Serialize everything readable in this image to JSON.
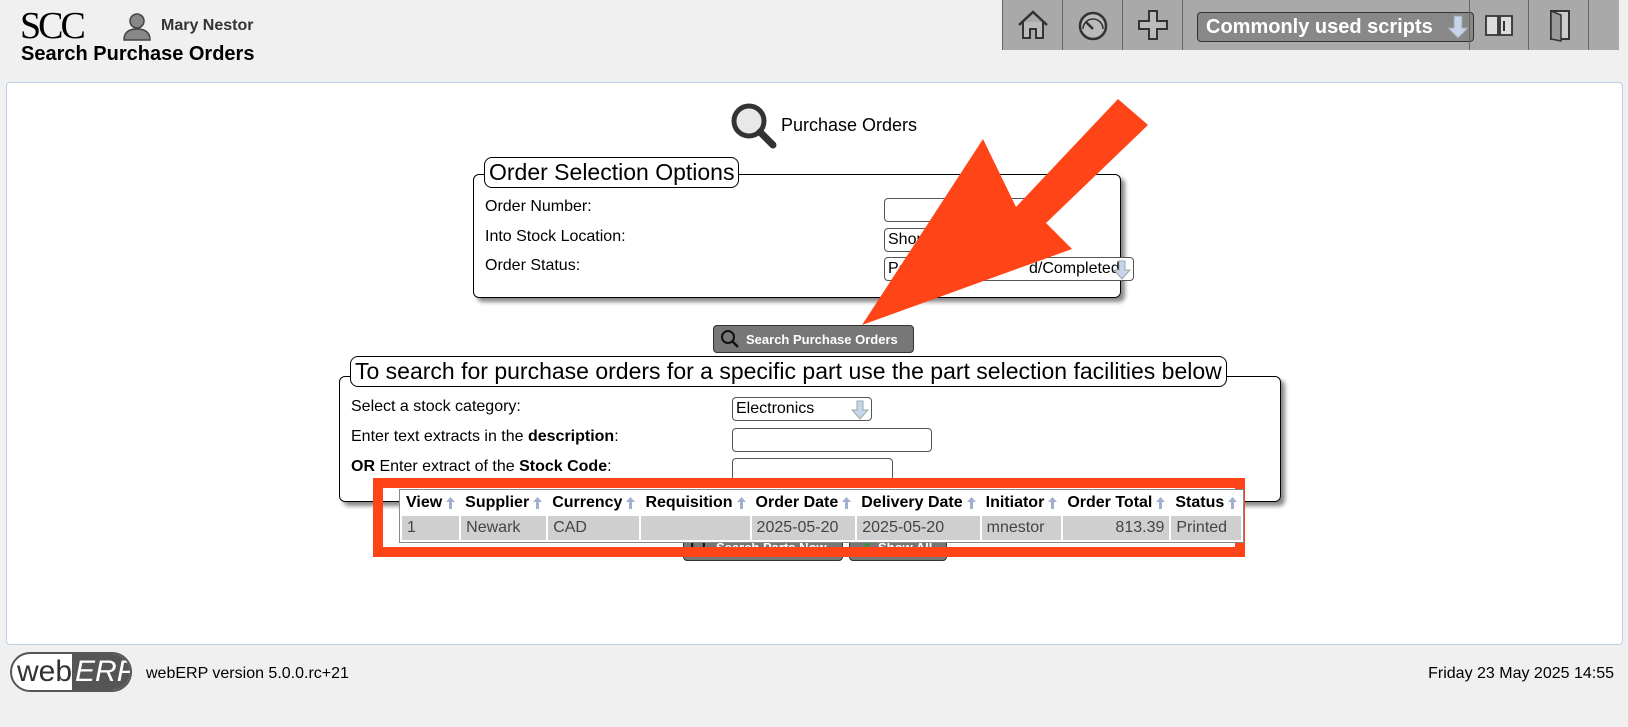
{
  "header": {
    "logo": "SCC",
    "user_name": "Mary Nestor",
    "page_title": "Search Purchase Orders",
    "scripts_label": "Commonly used scripts"
  },
  "main": {
    "heading": "Purchase Orders",
    "order_options": {
      "legend": "Order Selection Options",
      "order_number_label": "Order Number:",
      "order_number_value": "",
      "stock_location_label": "Into Stock Location:",
      "stock_location_value": "Shop",
      "order_status_label": "Order Status:",
      "order_status_value_start": "Pe",
      "order_status_value_end": "d/Completed"
    },
    "search_po_button": "Search Purchase Orders",
    "part_selection": {
      "legend": "To search for purchase orders for a specific part use the part selection facilities below",
      "category_label": "Select a stock category:",
      "category_value": "Electronics",
      "desc_label_pre": "Enter text extracts in the ",
      "desc_label_bold": "description",
      "desc_label_post": ":",
      "code_label_or": "OR",
      "code_label_mid": " Enter extract of the ",
      "code_label_bold": "Stock Code",
      "code_label_post": ":"
    },
    "search_parts_button": "Search Parts Now",
    "show_all_button": "Show All",
    "results": {
      "headers": [
        "View",
        "Supplier",
        "Currency",
        "Requisition",
        "Order Date",
        "Delivery Date",
        "Initiator",
        "Order Total",
        "Status"
      ],
      "rows": [
        [
          "1",
          "Newark",
          "CAD",
          "",
          "2025-05-20",
          "2025-05-20",
          "mnestor",
          "813.39",
          "Printed"
        ]
      ]
    }
  },
  "footer": {
    "logo_web": "web",
    "logo_erp": "ERP",
    "version": "webERP version 5.0.0.rc+21",
    "datetime": "Friday 23 May 2025 14:55"
  },
  "colors": {
    "annotation": "#ff4517",
    "toolbar": "#a9a9a9",
    "button": "#777777"
  }
}
